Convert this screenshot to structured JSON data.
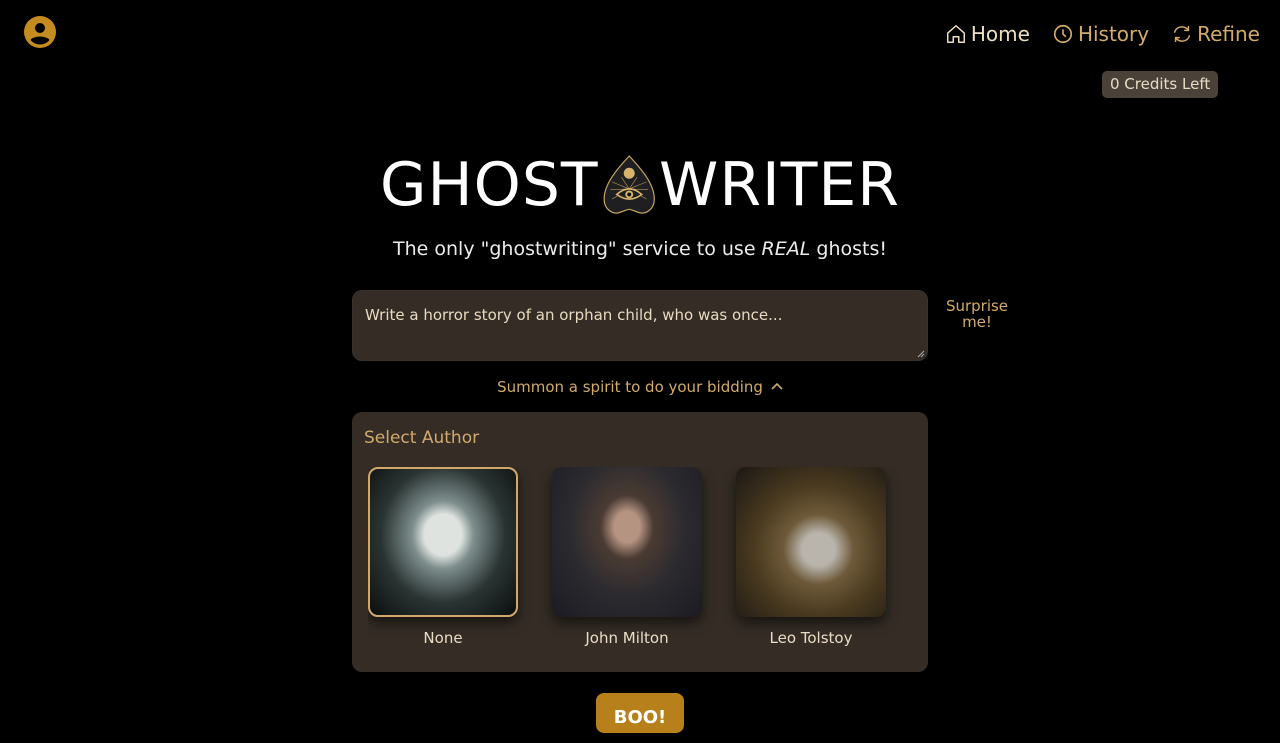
{
  "header": {
    "avatar_icon": "user-circle-icon",
    "nav": [
      {
        "label": "Home",
        "icon": "home-icon",
        "active": true
      },
      {
        "label": "History",
        "icon": "clock-icon",
        "active": false
      },
      {
        "label": "Refine",
        "icon": "refresh-icon",
        "active": false
      }
    ],
    "credits_label": "0 Credits Left"
  },
  "brand": {
    "left": "GHOST",
    "right": "WRITER",
    "logo_icon": "planchette-eye-icon",
    "tagline_pre": "The only \"ghostwriting\" service to use ",
    "tagline_em": "REAL",
    "tagline_post": " ghosts!"
  },
  "prompt": {
    "value": "Write a horror story of an orphan child, who was once...",
    "surprise_label": "Surprise me!"
  },
  "summon": {
    "label": "Summon a spirit to do your bidding",
    "icon": "chevron-up-icon"
  },
  "author_panel": {
    "title": "Select Author",
    "authors": [
      {
        "name": "None",
        "selected": true
      },
      {
        "name": "John Milton",
        "selected": false
      },
      {
        "name": "Leo Tolstoy",
        "selected": false
      }
    ]
  },
  "submit": {
    "label": "BOO!"
  },
  "colors": {
    "accent": "#b8801a",
    "gold_text": "#d2aa6c",
    "panel": "#342c25",
    "badge": "#4a4239"
  }
}
